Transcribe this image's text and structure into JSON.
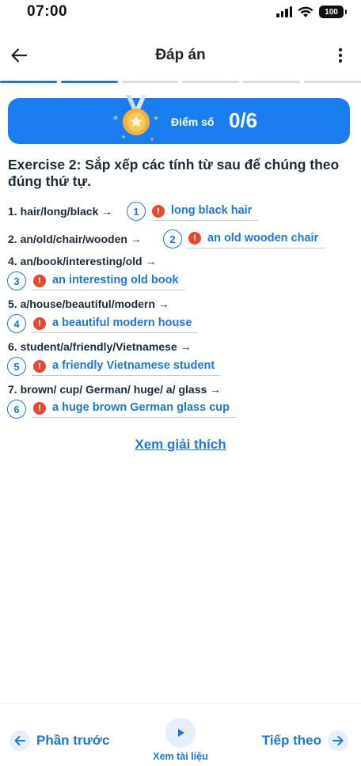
{
  "status_bar": {
    "time": "07:00",
    "battery": "100"
  },
  "header": {
    "title": "Đáp án"
  },
  "progress": {
    "total_segments": 6,
    "active_segments": 2
  },
  "score": {
    "label": "Điểm số",
    "value": "0/6"
  },
  "exercise": {
    "title": "Exercise 2: Sắp xếp các tính từ sau để chúng theo đúng thứ tự.",
    "questions": [
      {
        "prompt": "1. hair/long/black →",
        "number": "1",
        "answer": "long black hair"
      },
      {
        "prompt": "2. an/old/chair/wooden →",
        "number": "2",
        "answer": "an old wooden chair"
      },
      {
        "prompt": "4. an/book/interesting/old →",
        "number": "3",
        "answer": "an interesting old book"
      },
      {
        "prompt": "5. a/house/beautiful/modern →",
        "number": "4",
        "answer": "a beautiful modern house"
      },
      {
        "prompt": "6. student/a/friendly/Vietnamese →",
        "number": "5",
        "answer": "a friendly Vietnamese student"
      },
      {
        "prompt": "7. brown/ cup/ German/ huge/ a/ glass →",
        "number": "6",
        "answer": "a huge brown German glass cup"
      }
    ],
    "status_icon": "!"
  },
  "explain_link": "Xem giải thích",
  "footer": {
    "prev_label": "Phần trước",
    "doc_label": "Xem tài liệu",
    "next_label": "Tiếp theo"
  },
  "colors": {
    "accent": "#1a78e0",
    "banner": "#1a7ef0",
    "error": "#e5492f"
  }
}
